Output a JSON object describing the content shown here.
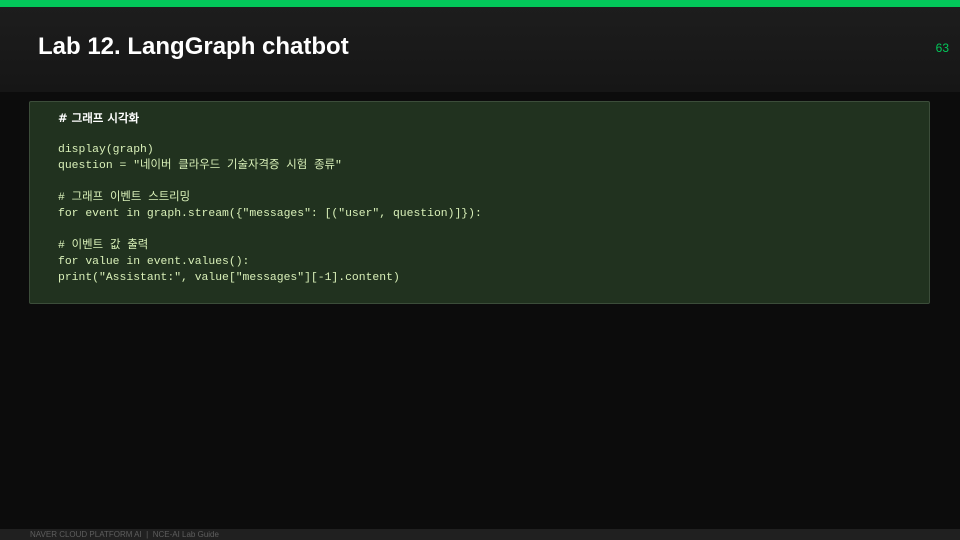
{
  "header": {
    "title": "Lab 12. LangGraph chatbot",
    "page_number": "63"
  },
  "code_panel": {
    "heading": "# 그래프 시각화",
    "lines": [
      "",
      "display(graph)",
      "question = \"네이버 클라우드 기술자격증 시험 종류\"",
      "",
      "# 그래프 이벤트 스트리밍",
      "for event in graph.stream({\"messages\": [(\"user\", question)]}):",
      "",
      "# 이벤트 값 출력",
      "for value in event.values():",
      "print(\"Assistant:\", value[\"messages\"][-1].content)"
    ]
  },
  "footer": {
    "text": "NAVER CLOUD PLATFORM AI  |  NCE-AI Lab Guide"
  },
  "colors": {
    "accent": "#03c75a",
    "code_background": "#21321f",
    "code_text": "#d9f0b8"
  }
}
